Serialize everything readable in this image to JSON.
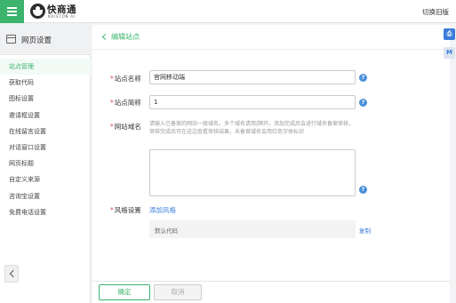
{
  "topbar": {
    "logo_text": "快商通",
    "logo_sub": "KRISTON AI",
    "switch_label": "切换旧版"
  },
  "sidebar": {
    "title": "网页设置",
    "items": [
      {
        "label": "站点管理",
        "active": true
      },
      {
        "label": "获取代码"
      },
      {
        "label": "图标设置"
      },
      {
        "label": "邀请框设置"
      },
      {
        "label": "在线留言设置"
      },
      {
        "label": "对话窗口设置"
      },
      {
        "label": "网页标题"
      },
      {
        "label": "自定义来源"
      },
      {
        "label": "咨询宝设置"
      },
      {
        "label": "免费电话设置"
      }
    ]
  },
  "main": {
    "title": "编辑站点",
    "site_name": {
      "label": "站点名称",
      "value": "官网移动端"
    },
    "site_abbr": {
      "label": "站点简称",
      "value": "1"
    },
    "domain": {
      "label": "网站域名",
      "hint": "请输入已备案的网站一级域名。多个域名请用|隔开。添加完成后会进行域名备案审核，审核完成后可在这边查看审核结果，未备案域名会用红色字体标识",
      "value": ""
    },
    "style": {
      "label": "风格设置",
      "add_link": "添加风格",
      "default_name": "默认代码",
      "copy_link": "复制"
    }
  },
  "footer": {
    "confirm_label": "确定",
    "cancel_label": "取消"
  },
  "float_buttons": [
    {
      "icon": "printer-icon",
      "glyph": "⎙"
    },
    {
      "icon": "m-icon",
      "glyph": "M"
    }
  ],
  "colors": {
    "brand_green": "#3cb46e",
    "link_blue": "#3b7dd8",
    "required_red": "#e14c4c"
  }
}
